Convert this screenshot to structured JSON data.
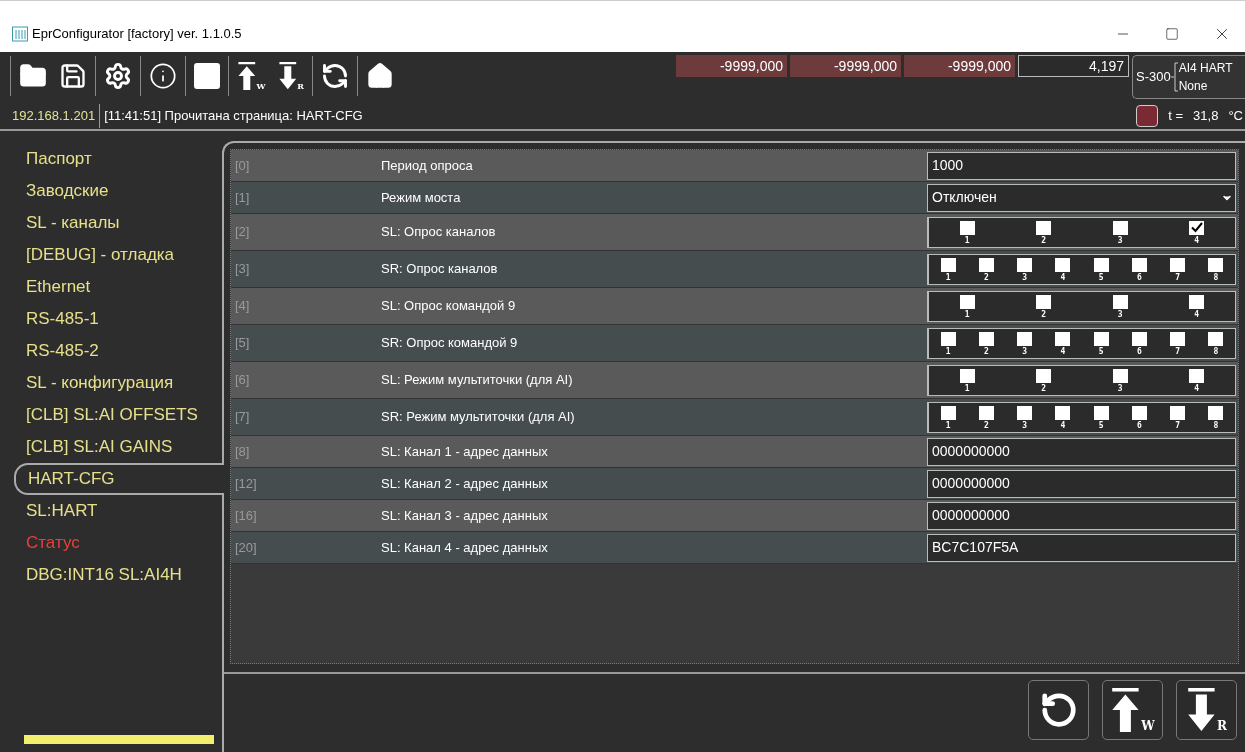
{
  "window": {
    "title": "EprConfigurator [factory] ver. 1.1.0.5"
  },
  "toolbar": {
    "buttons": [
      {
        "kind": "open"
      },
      {
        "kind": "save"
      },
      {
        "kind": "settings"
      },
      {
        "kind": "info"
      },
      {
        "kind": "stop"
      },
      {
        "kind": "write",
        "sub": "W"
      },
      {
        "kind": "read",
        "sub": "R"
      },
      {
        "kind": "sync"
      },
      {
        "kind": "home"
      }
    ]
  },
  "readouts": [
    {
      "value": "-9999,000",
      "alarm": true
    },
    {
      "value": "-9999,000",
      "alarm": true
    },
    {
      "value": "-9999,000",
      "alarm": true
    },
    {
      "value": "4,197",
      "alarm": false
    }
  ],
  "device": {
    "model": "S-300",
    "lines": [
      "AI4 HART",
      "None"
    ]
  },
  "status": {
    "address": "192.168.1.201",
    "message": "[11:41:51] Прочитана страница: HART-CFG",
    "indicator": {
      "on": true
    },
    "temperature_label": "t =",
    "temperature": "31,8",
    "unit": "°C"
  },
  "sidebar": {
    "items": [
      {
        "label": "Паспорт",
        "selected": false,
        "color": "#e6e08c"
      },
      {
        "label": "Заводские",
        "selected": false,
        "color": "#e6e08c"
      },
      {
        "label": "SL - каналы",
        "selected": false,
        "color": "#e6e08c"
      },
      {
        "label": "[DEBUG] - отладка",
        "selected": false,
        "color": "#e6e08c"
      },
      {
        "label": "Ethernet",
        "selected": false,
        "color": "#e6e08c"
      },
      {
        "label": "RS-485-1",
        "selected": false,
        "color": "#e6e08c"
      },
      {
        "label": "RS-485-2",
        "selected": false,
        "color": "#e6e08c"
      },
      {
        "label": "SL - конфигурация",
        "selected": false,
        "color": "#e6e08c"
      },
      {
        "label": "[CLB] SL:AI OFFSETS",
        "selected": false,
        "color": "#e6e08c"
      },
      {
        "label": "[CLB] SL:AI GAINS",
        "selected": false,
        "color": "#e6e08c"
      },
      {
        "label": "HART-CFG",
        "selected": true,
        "color": "#e6e08c"
      },
      {
        "label": "SL:HART",
        "selected": false,
        "color": "#e6e08c"
      },
      {
        "label": "Статус",
        "selected": false,
        "color": "#e8403a"
      },
      {
        "label": "DBG:INT16 SL:AI4H",
        "selected": false,
        "color": "#e6e08c"
      }
    ]
  },
  "table": {
    "rows": [
      {
        "index": "[0]",
        "label": "Период опроса",
        "kind": "text",
        "value": "1000"
      },
      {
        "index": "[1]",
        "label": "Режим моста",
        "kind": "select",
        "value": "Отключен"
      },
      {
        "index": "[2]",
        "label": "SL: Опрос каналов",
        "kind": "checks",
        "checks": [
          {
            "label": "1",
            "checked": false
          },
          {
            "label": "2",
            "checked": false
          },
          {
            "label": "3",
            "checked": false
          },
          {
            "label": "4",
            "checked": true
          }
        ]
      },
      {
        "index": "[3]",
        "label": "SR: Опрос каналов",
        "kind": "checks",
        "checks": [
          {
            "label": "1",
            "checked": false
          },
          {
            "label": "2",
            "checked": false
          },
          {
            "label": "3",
            "checked": false
          },
          {
            "label": "4",
            "checked": false
          },
          {
            "label": "5",
            "checked": false
          },
          {
            "label": "6",
            "checked": false
          },
          {
            "label": "7",
            "checked": false
          },
          {
            "label": "8",
            "checked": false
          }
        ]
      },
      {
        "index": "[4]",
        "label": "SL: Опрос командой 9",
        "kind": "checks",
        "checks": [
          {
            "label": "1",
            "checked": false
          },
          {
            "label": "2",
            "checked": false
          },
          {
            "label": "3",
            "checked": false
          },
          {
            "label": "4",
            "checked": false
          }
        ]
      },
      {
        "index": "[5]",
        "label": "SR: Опрос командой 9",
        "kind": "checks",
        "checks": [
          {
            "label": "1",
            "checked": false
          },
          {
            "label": "2",
            "checked": false
          },
          {
            "label": "3",
            "checked": false
          },
          {
            "label": "4",
            "checked": false
          },
          {
            "label": "5",
            "checked": false
          },
          {
            "label": "6",
            "checked": false
          },
          {
            "label": "7",
            "checked": false
          },
          {
            "label": "8",
            "checked": false
          }
        ]
      },
      {
        "index": "[6]",
        "label": "SL: Режим мультиточки (для AI)",
        "kind": "checks",
        "checks": [
          {
            "label": "1",
            "checked": false
          },
          {
            "label": "2",
            "checked": false
          },
          {
            "label": "3",
            "checked": false
          },
          {
            "label": "4",
            "checked": false
          }
        ]
      },
      {
        "index": "[7]",
        "label": "SR: Режим мультиточки (для AI)",
        "kind": "checks",
        "checks": [
          {
            "label": "1",
            "checked": false
          },
          {
            "label": "2",
            "checked": false
          },
          {
            "label": "3",
            "checked": false
          },
          {
            "label": "4",
            "checked": false
          },
          {
            "label": "5",
            "checked": false
          },
          {
            "label": "6",
            "checked": false
          },
          {
            "label": "7",
            "checked": false
          },
          {
            "label": "8",
            "checked": false
          }
        ]
      },
      {
        "index": "[8]",
        "label": "SL: Канал 1 - адрес данных",
        "kind": "text",
        "value": "0000000000"
      },
      {
        "index": "[12]",
        "label": "SL: Канал 2 - адрес данных",
        "kind": "text",
        "value": "0000000000"
      },
      {
        "index": "[16]",
        "label": "SL: Канал 3 - адрес данных",
        "kind": "text",
        "value": "0000000000"
      },
      {
        "index": "[20]",
        "label": "SL: Канал 4 - адрес данных",
        "kind": "text",
        "value": "BC7C107F5A"
      }
    ]
  },
  "footer": {
    "buttons": [
      {
        "kind": "refresh"
      },
      {
        "kind": "write",
        "sub": "W"
      },
      {
        "kind": "read",
        "sub": "R"
      }
    ]
  }
}
